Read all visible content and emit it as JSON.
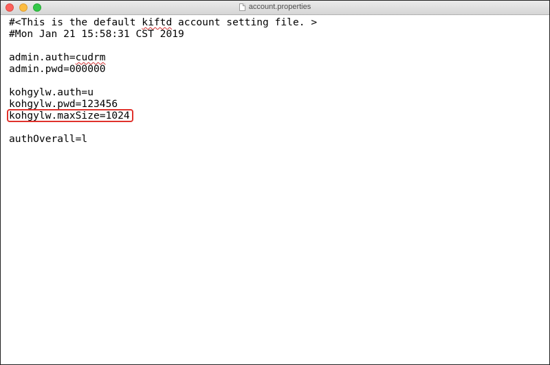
{
  "window": {
    "title": "account.properties"
  },
  "editor": {
    "lines": [
      {
        "pre": "#<This is the default ",
        "flag": "kiftd",
        "post": " account setting file. >"
      },
      {
        "text": "#Mon Jan 21 15:58:31 CST 2019"
      },
      {
        "text": ""
      },
      {
        "pre": "admin.auth=",
        "flag": "cudrm",
        "post": ""
      },
      {
        "text": "admin.pwd=000000"
      },
      {
        "text": ""
      },
      {
        "text": "kohgylw.auth=u"
      },
      {
        "text": "kohgylw.pwd=123456"
      },
      {
        "text": "kohgylw.maxSize=1024"
      },
      {
        "text": ""
      },
      {
        "text": "authOverall=l"
      }
    ]
  },
  "highlight": {
    "color": "#e0312b"
  }
}
